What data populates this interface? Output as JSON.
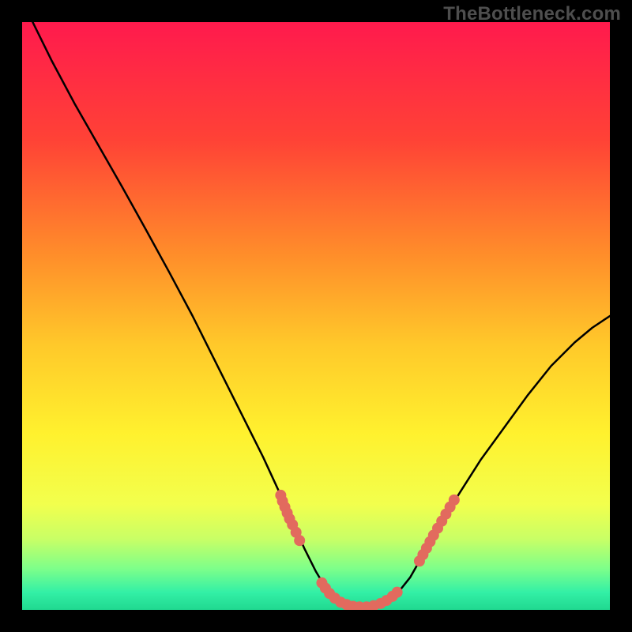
{
  "watermark": "TheBottleneck.com",
  "chart_data": {
    "type": "line",
    "title": "",
    "xlabel": "",
    "ylabel": "",
    "xlim": [
      0,
      1
    ],
    "ylim": [
      0,
      1
    ],
    "background_gradient": {
      "stops": [
        {
          "offset": 0.0,
          "color": "#ff1a4d"
        },
        {
          "offset": 0.2,
          "color": "#ff4236"
        },
        {
          "offset": 0.4,
          "color": "#ff8f2a"
        },
        {
          "offset": 0.55,
          "color": "#ffc92a"
        },
        {
          "offset": 0.7,
          "color": "#fff12e"
        },
        {
          "offset": 0.82,
          "color": "#f2ff4d"
        },
        {
          "offset": 0.88,
          "color": "#c8ff66"
        },
        {
          "offset": 0.93,
          "color": "#7dff8a"
        },
        {
          "offset": 0.97,
          "color": "#33f0a6"
        },
        {
          "offset": 1.0,
          "color": "#20d890"
        }
      ]
    },
    "series": [
      {
        "name": "bottleneck-curve",
        "stroke": "#000000",
        "stroke_width": 2.5,
        "points": [
          {
            "x": 0.018,
            "y": 1.0
          },
          {
            "x": 0.05,
            "y": 0.935
          },
          {
            "x": 0.09,
            "y": 0.86
          },
          {
            "x": 0.13,
            "y": 0.79
          },
          {
            "x": 0.17,
            "y": 0.72
          },
          {
            "x": 0.21,
            "y": 0.648
          },
          {
            "x": 0.25,
            "y": 0.575
          },
          {
            "x": 0.29,
            "y": 0.5
          },
          {
            "x": 0.32,
            "y": 0.44
          },
          {
            "x": 0.35,
            "y": 0.38
          },
          {
            "x": 0.38,
            "y": 0.32
          },
          {
            "x": 0.41,
            "y": 0.26
          },
          {
            "x": 0.44,
            "y": 0.195
          },
          {
            "x": 0.46,
            "y": 0.15
          },
          {
            "x": 0.48,
            "y": 0.105
          },
          {
            "x": 0.5,
            "y": 0.065
          },
          {
            "x": 0.515,
            "y": 0.04
          },
          {
            "x": 0.53,
            "y": 0.022
          },
          {
            "x": 0.545,
            "y": 0.012
          },
          {
            "x": 0.56,
            "y": 0.007
          },
          {
            "x": 0.58,
            "y": 0.005
          },
          {
            "x": 0.6,
            "y": 0.007
          },
          {
            "x": 0.62,
            "y": 0.015
          },
          {
            "x": 0.64,
            "y": 0.03
          },
          {
            "x": 0.66,
            "y": 0.055
          },
          {
            "x": 0.68,
            "y": 0.09
          },
          {
            "x": 0.7,
            "y": 0.125
          },
          {
            "x": 0.72,
            "y": 0.16
          },
          {
            "x": 0.745,
            "y": 0.2
          },
          {
            "x": 0.78,
            "y": 0.255
          },
          {
            "x": 0.82,
            "y": 0.31
          },
          {
            "x": 0.86,
            "y": 0.365
          },
          {
            "x": 0.9,
            "y": 0.415
          },
          {
            "x": 0.94,
            "y": 0.455
          },
          {
            "x": 0.97,
            "y": 0.48
          },
          {
            "x": 1.0,
            "y": 0.5
          }
        ]
      }
    ],
    "markers": {
      "left_cluster": [
        {
          "x": 0.44,
          "y": 0.195
        },
        {
          "x": 0.443,
          "y": 0.185
        },
        {
          "x": 0.447,
          "y": 0.175
        },
        {
          "x": 0.451,
          "y": 0.165
        },
        {
          "x": 0.455,
          "y": 0.155
        },
        {
          "x": 0.46,
          "y": 0.145
        },
        {
          "x": 0.466,
          "y": 0.132
        },
        {
          "x": 0.472,
          "y": 0.118
        }
      ],
      "bottom_cluster": [
        {
          "x": 0.51,
          "y": 0.046
        },
        {
          "x": 0.516,
          "y": 0.037
        },
        {
          "x": 0.523,
          "y": 0.028
        },
        {
          "x": 0.532,
          "y": 0.02
        },
        {
          "x": 0.542,
          "y": 0.013
        },
        {
          "x": 0.552,
          "y": 0.009
        },
        {
          "x": 0.563,
          "y": 0.006
        },
        {
          "x": 0.574,
          "y": 0.005
        },
        {
          "x": 0.586,
          "y": 0.005
        },
        {
          "x": 0.598,
          "y": 0.007
        },
        {
          "x": 0.61,
          "y": 0.011
        },
        {
          "x": 0.62,
          "y": 0.016
        },
        {
          "x": 0.63,
          "y": 0.023
        },
        {
          "x": 0.638,
          "y": 0.03
        }
      ],
      "right_cluster": [
        {
          "x": 0.676,
          "y": 0.083
        },
        {
          "x": 0.682,
          "y": 0.094
        },
        {
          "x": 0.688,
          "y": 0.105
        },
        {
          "x": 0.694,
          "y": 0.116
        },
        {
          "x": 0.7,
          "y": 0.127
        },
        {
          "x": 0.707,
          "y": 0.139
        },
        {
          "x": 0.714,
          "y": 0.151
        },
        {
          "x": 0.721,
          "y": 0.163
        },
        {
          "x": 0.728,
          "y": 0.175
        },
        {
          "x": 0.735,
          "y": 0.187
        }
      ],
      "color": "#e26a5e",
      "radius": 7
    }
  }
}
